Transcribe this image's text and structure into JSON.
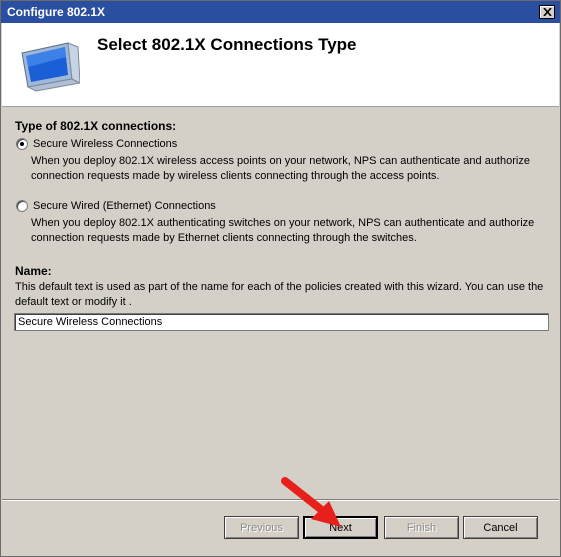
{
  "window": {
    "title": "Configure 802.1X"
  },
  "header": {
    "title": "Select 802.1X Connections Type",
    "icon": "computer-monitor-icon"
  },
  "connections": {
    "group_label": "Type of 802.1X connections:",
    "options": [
      {
        "label": "Secure Wireless Connections",
        "checked": true,
        "description": "When you deploy 802.1X wireless access points on your network, NPS can authenticate and authorize connection requests made by wireless clients connecting through the access points."
      },
      {
        "label": "Secure Wired (Ethernet) Connections",
        "checked": false,
        "description": "When you deploy 802.1X authenticating switches on your network, NPS can authenticate and authorize connection requests made by Ethernet clients connecting through the switches."
      }
    ]
  },
  "name": {
    "label": "Name:",
    "description": "This default text is used as part of the name for each of the policies created with this wizard. You can use the default text or modify it .",
    "value": "Secure Wireless Connections"
  },
  "buttons": {
    "previous": "Previous",
    "next": "Next",
    "finish": "Finish",
    "cancel": "Cancel"
  },
  "annotation": {
    "arrow_color": "#e8201c"
  }
}
